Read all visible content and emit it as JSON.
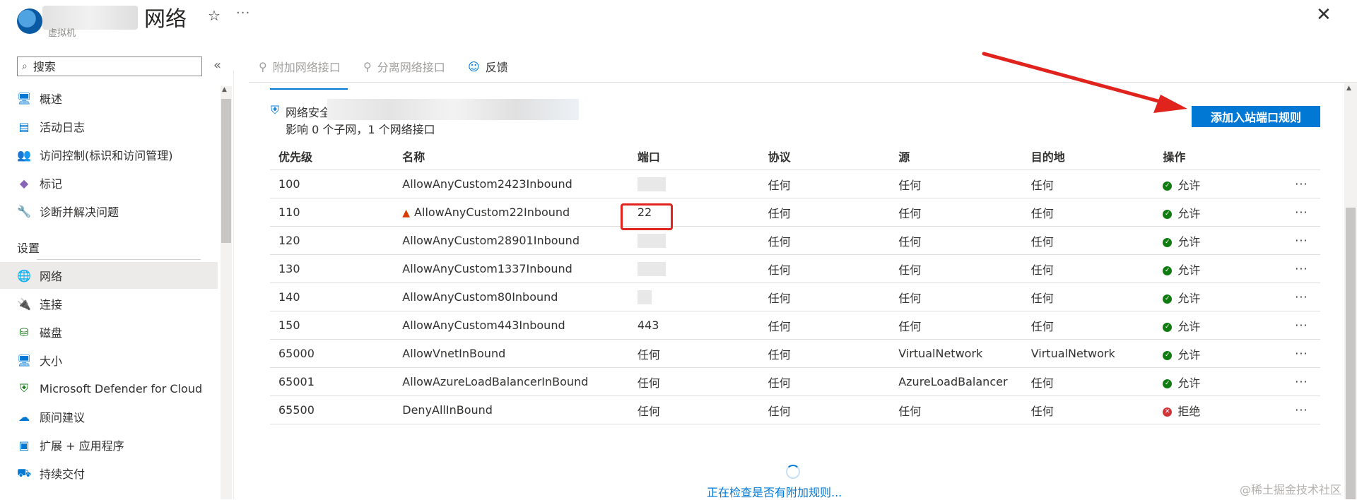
{
  "header": {
    "title": "网络",
    "subtitle": "虚拟机"
  },
  "sidebar": {
    "search_placeholder": "搜索",
    "collapse_glyph": "«",
    "items": [
      {
        "label": "概述",
        "icon": "monitor-icon"
      },
      {
        "label": "活动日志",
        "icon": "log-icon"
      },
      {
        "label": "访问控制(标识和访问管理)",
        "icon": "users-icon"
      },
      {
        "label": "标记",
        "icon": "tag-icon"
      },
      {
        "label": "诊断并解决问题",
        "icon": "wrench-icon"
      }
    ],
    "section_label": "设置",
    "settings_items": [
      {
        "label": "网络",
        "icon": "network-icon",
        "active": true
      },
      {
        "label": "连接",
        "icon": "plug-icon"
      },
      {
        "label": "磁盘",
        "icon": "disk-icon"
      },
      {
        "label": "大小",
        "icon": "monitor-icon"
      },
      {
        "label": "Microsoft Defender for Cloud",
        "icon": "shield-icon"
      },
      {
        "label": "顾问建议",
        "icon": "advisor-icon"
      },
      {
        "label": "扩展 + 应用程序",
        "icon": "extension-icon"
      },
      {
        "label": "持续交付",
        "icon": "delivery-icon"
      }
    ]
  },
  "toolbar": {
    "attach": "附加网络接口",
    "detach": "分离网络接口",
    "feedback": "反馈"
  },
  "nsg": {
    "label": "网络安全",
    "impact": "影响 0 个子网，1 个网络接口"
  },
  "add_inbound_button": "添加入站端口规则",
  "table": {
    "headers": [
      "优先级",
      "名称",
      "端口",
      "协议",
      "源",
      "目的地",
      "操作"
    ],
    "rows": [
      {
        "priority": "100",
        "name": "AllowAnyCustom2423Inbound",
        "port": "",
        "protocol": "任何",
        "source": "任何",
        "dest": "任何",
        "action": "允许"
      },
      {
        "priority": "110",
        "name": "AllowAnyCustom22Inbound",
        "port": "22",
        "protocol": "任何",
        "source": "任何",
        "dest": "任何",
        "action": "允许",
        "warning": true
      },
      {
        "priority": "120",
        "name": "AllowAnyCustom28901Inbound",
        "port": "",
        "protocol": "任何",
        "source": "任何",
        "dest": "任何",
        "action": "允许"
      },
      {
        "priority": "130",
        "name": "AllowAnyCustom1337Inbound",
        "port": "",
        "protocol": "任何",
        "source": "任何",
        "dest": "任何",
        "action": "允许"
      },
      {
        "priority": "140",
        "name": "AllowAnyCustom80Inbound",
        "port": "",
        "protocol": "任何",
        "source": "任何",
        "dest": "任何",
        "action": "允许"
      },
      {
        "priority": "150",
        "name": "AllowAnyCustom443Inbound",
        "port": "443",
        "protocol": "任何",
        "source": "任何",
        "dest": "任何",
        "action": "允许"
      },
      {
        "priority": "65000",
        "name": "AllowVnetInBound",
        "port": "任何",
        "protocol": "任何",
        "source": "VirtualNetwork",
        "dest": "VirtualNetwork",
        "action": "允许"
      },
      {
        "priority": "65001",
        "name": "AllowAzureLoadBalancerInBound",
        "port": "任何",
        "protocol": "任何",
        "source": "AzureLoadBalancer",
        "dest": "任何",
        "action": "允许"
      },
      {
        "priority": "65500",
        "name": "DenyAllInBound",
        "port": "任何",
        "protocol": "任何",
        "source": "任何",
        "dest": "任何",
        "action": "拒绝",
        "deny": true
      }
    ]
  },
  "loading_text": "正在检查是否有附加规则...",
  "watermark": "@稀土掘金技术社区",
  "colors": {
    "accent": "#0078d4",
    "allow": "#107c10",
    "deny": "#d13438",
    "highlight": "#e0231c"
  }
}
